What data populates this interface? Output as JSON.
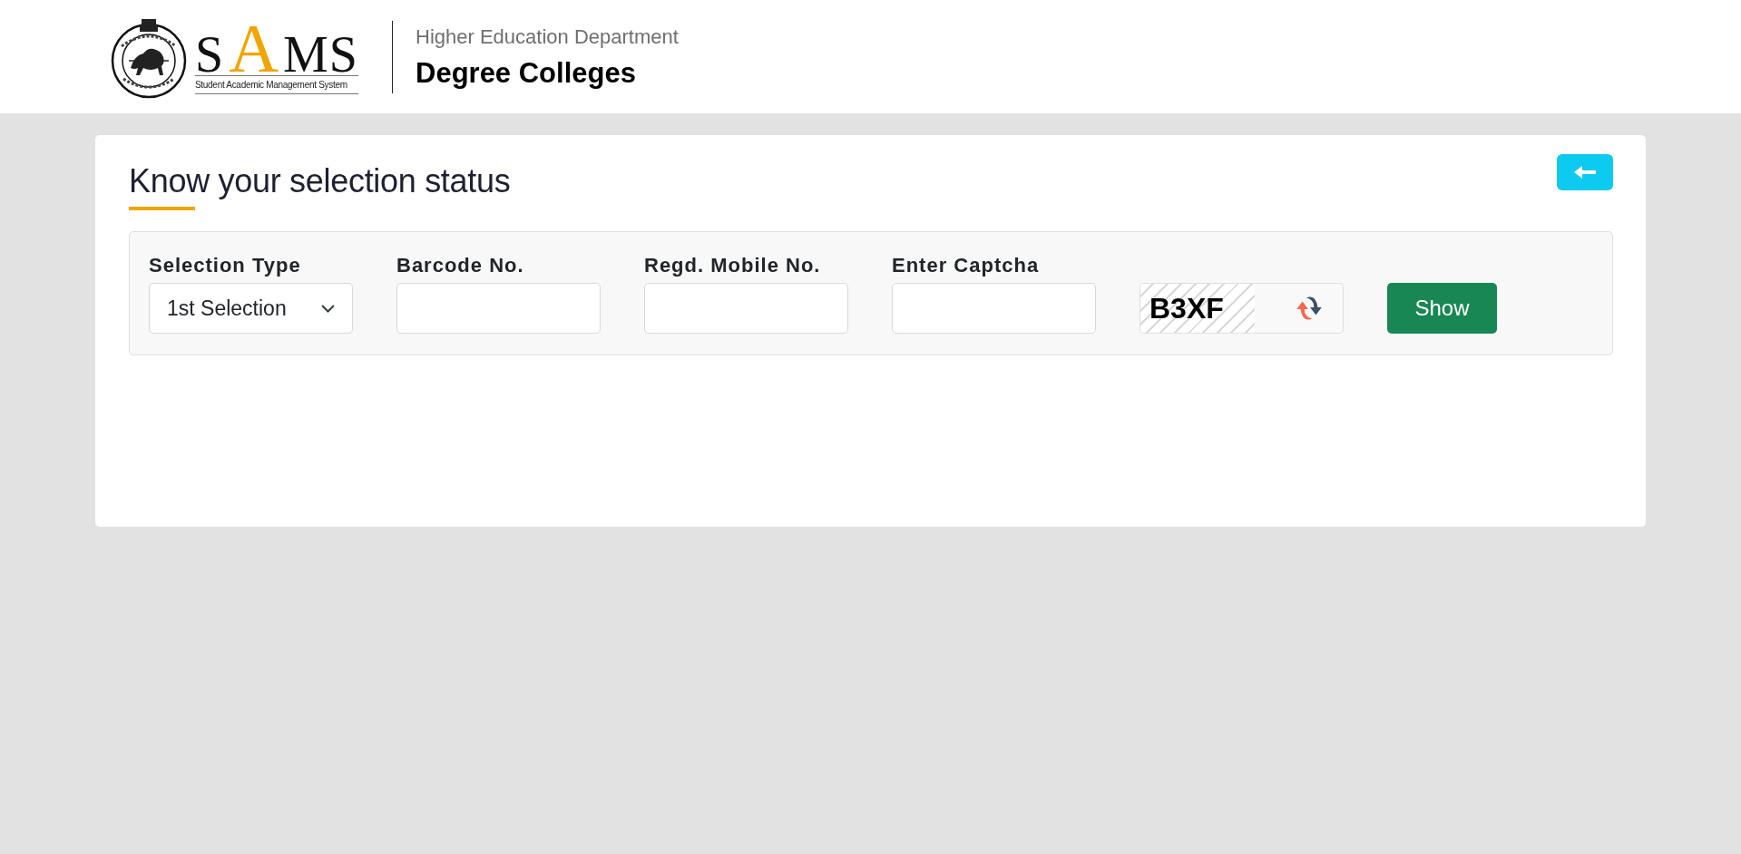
{
  "header": {
    "logo": {
      "letters": [
        {
          "text": "S",
          "accent": false
        },
        {
          "text": "A",
          "accent": true
        },
        {
          "text": "MS",
          "accent": false
        }
      ],
      "tagline": "Student Academic Management System"
    },
    "department": "Higher Education Department",
    "portal": "Degree Colleges"
  },
  "page": {
    "title": "Know your selection status"
  },
  "form": {
    "fields": [
      {
        "kind": "select",
        "label": "Selection Type",
        "value": "1st Selection"
      },
      {
        "kind": "text",
        "label": "Barcode No."
      },
      {
        "kind": "text",
        "label": "Regd. Mobile No."
      },
      {
        "kind": "text",
        "label": "Enter Captcha"
      }
    ],
    "captcha": {
      "text": "B3XF"
    },
    "submit_button": "Show"
  }
}
